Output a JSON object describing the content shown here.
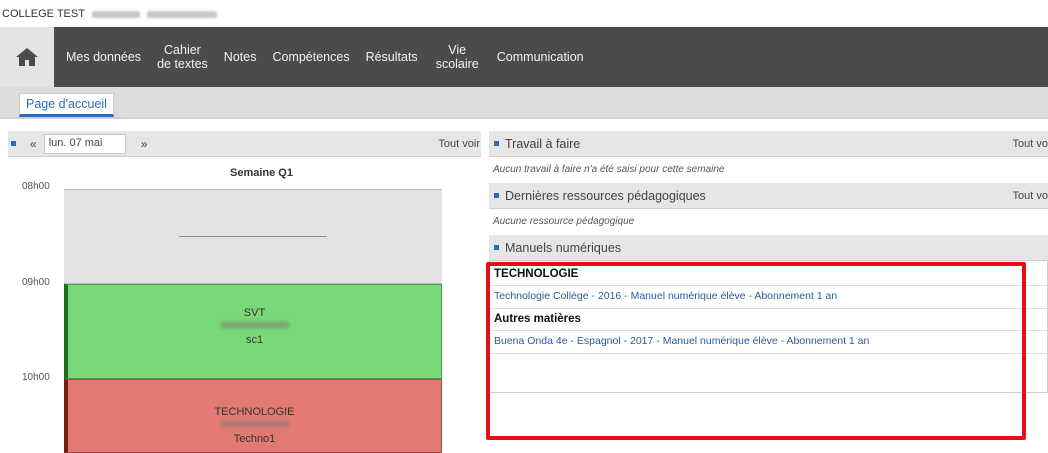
{
  "school": {
    "name": "COLLEGE TEST"
  },
  "nav": {
    "items": [
      {
        "label": "Mes données"
      },
      {
        "label": "Cahier\nde textes"
      },
      {
        "label": "Notes"
      },
      {
        "label": "Compétences"
      },
      {
        "label": "Résultats"
      },
      {
        "label": "Vie\nscolaire"
      },
      {
        "label": "Communication"
      }
    ]
  },
  "subnav": {
    "active_tab": "Page d'accueil"
  },
  "agenda": {
    "prev_icon": "«",
    "next_icon": "»",
    "date": "lun. 07 mai",
    "tout_voir": "Tout voir",
    "week": "Semaine Q1",
    "hours": [
      "08h00",
      "09h00",
      "10h00"
    ],
    "courses": [
      {
        "subject": "SVT",
        "room": "sc1",
        "color": "#79d878"
      },
      {
        "subject": "TECHNOLOGIE",
        "room": "Techno1",
        "color": "#e27a73"
      }
    ]
  },
  "travail": {
    "title": "Travail à faire",
    "tout_voir": "Tout vo",
    "note": "Aucun travail à faire n'a été saisi pour cette semaine"
  },
  "ressources": {
    "title": "Dernières ressources pédagogiques",
    "tout_voir": "Tout vo",
    "note": "Aucune ressource pédagogique"
  },
  "manuels": {
    "title": "Manuels numériques",
    "groups": [
      {
        "category": "TECHNOLOGIE",
        "link": "Technologie Collège - 2016 - Manuel numérique élève - Abonnement 1 an"
      },
      {
        "category": "Autres matières",
        "link": "Buena Onda 4e - Espagnol - 2017 - Manuel numérique élève - Abonnement 1 an"
      }
    ]
  },
  "colors": {
    "accent": "#2c6bb5",
    "navbar": "#4b4b4b",
    "highlight": "#e20f16"
  }
}
